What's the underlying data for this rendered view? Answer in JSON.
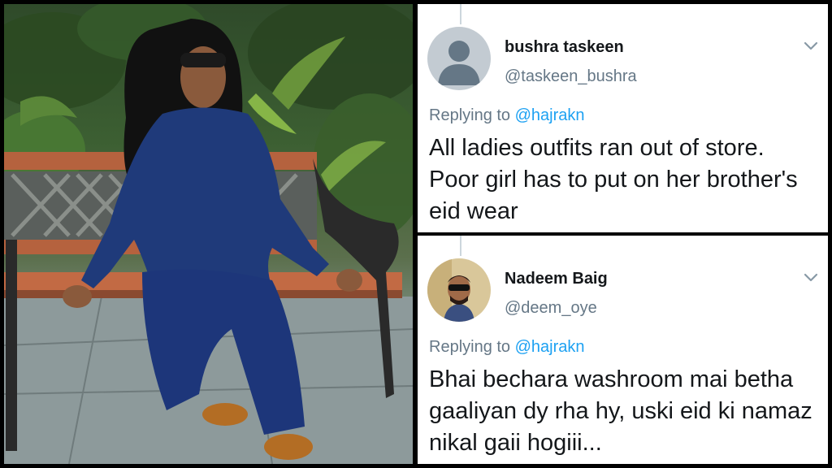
{
  "photo": {
    "description_icon": "woman-on-bench-photo"
  },
  "tweets": [
    {
      "display_name": "bushra taskeen",
      "handle": "@taskeen_bushra",
      "replying_label": "Replying to",
      "replying_to": "@hajrakn",
      "text": "All ladies outfits ran out of store. Poor girl has to put on her brother's eid wear",
      "avatar_icon": "default-avatar-icon"
    },
    {
      "display_name": "Nadeem Baig",
      "handle": "@deem_oye",
      "replying_label": "Replying to",
      "replying_to": "@hajrakn",
      "text": "Bhai bechara washroom mai betha gaaliyan dy rha hy, uski eid ki namaz nikal gaii hogiii...",
      "avatar_icon": "profile-photo-avatar"
    }
  ],
  "colors": {
    "name": "#14171a",
    "secondary": "#657786",
    "link": "#1da1f2",
    "divider": "#000000"
  }
}
